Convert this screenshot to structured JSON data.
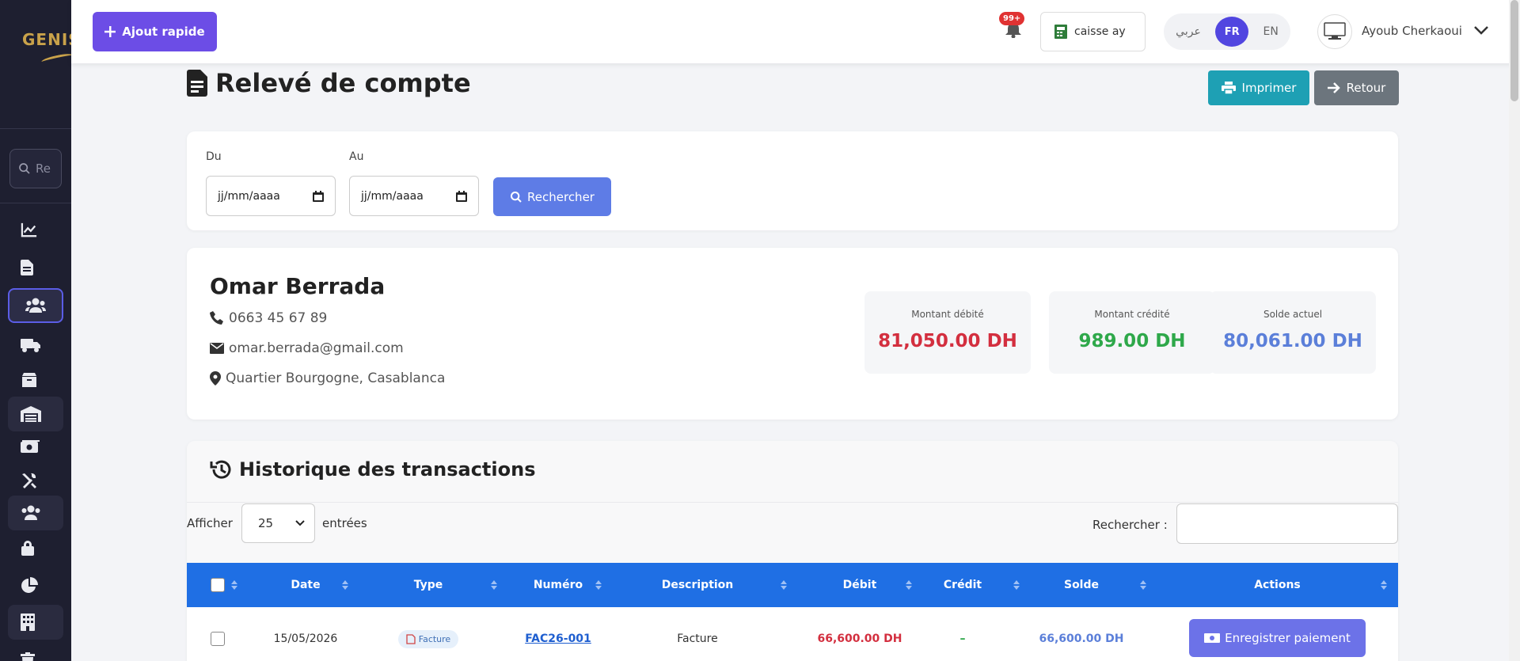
{
  "sidebar": {
    "logo_text": "GENIS",
    "search_placeholder": "Re",
    "nav_icons": [
      "chart-line-icon",
      "file-icon",
      "users-icon",
      "truck-icon",
      "box-icon",
      "warehouse-icon",
      "money-bill-icon",
      "tools-icon",
      "user-group-icon",
      "lock-icon",
      "pie-chart-icon",
      "building-icon",
      "trash-icon"
    ],
    "active_item": "users-icon"
  },
  "topbar": {
    "quick_add_label": "Ajout rapide",
    "notifications_count": "99+",
    "caisse_label": "caisse ay",
    "languages": [
      "عربي",
      "FR",
      "EN"
    ],
    "active_language": "FR",
    "user_name": "Ayoub Cherkaoui"
  },
  "page": {
    "title": "Relevé de compte",
    "print_label": "Imprimer",
    "back_label": "Retour"
  },
  "filters": {
    "from_label": "Du",
    "to_label": "Au",
    "from_value": "jj/mm/aaaa",
    "to_value": "jj/mm/aaaa",
    "search_label": "Rechercher"
  },
  "client": {
    "name": "Omar Berrada",
    "phone": "0663 45 67 89",
    "email": "omar.berrada@gmail.com",
    "address": "Quartier Bourgogne, Casablanca"
  },
  "stats": [
    {
      "label": "Montant débité",
      "value": "81,050.00 DH",
      "color": "#d32f3f"
    },
    {
      "label": "Montant crédité",
      "value": "989.00 DH",
      "color": "#2ea84a"
    },
    {
      "label": "Solde actuel",
      "value": "80,061.00 DH",
      "color": "#5b7fd9"
    }
  ],
  "history": {
    "title": "Historique des transactions",
    "show_label": "Afficher",
    "page_size": "25",
    "entries_label": "entrées",
    "search_label": "Rechercher :",
    "columns": [
      "Date",
      "Type",
      "Numéro",
      "Description",
      "Débit",
      "Crédit",
      "Solde",
      "Actions"
    ],
    "rows": [
      {
        "date": "15/05/2026",
        "type": "Facture",
        "numero": "FAC26-001",
        "description": "Facture",
        "debit": "66,600.00 DH",
        "credit": "–",
        "solde": "66,600.00 DH",
        "action_label": "Enregistrer paiement"
      }
    ]
  },
  "colors": {
    "sidebar_bg": "#1e1f30",
    "accent_purple": "#6c4de6",
    "table_header": "#1f6fe4",
    "debit": "#d32f3f",
    "credit": "#2ea84a",
    "solde": "#5b7fd9"
  }
}
